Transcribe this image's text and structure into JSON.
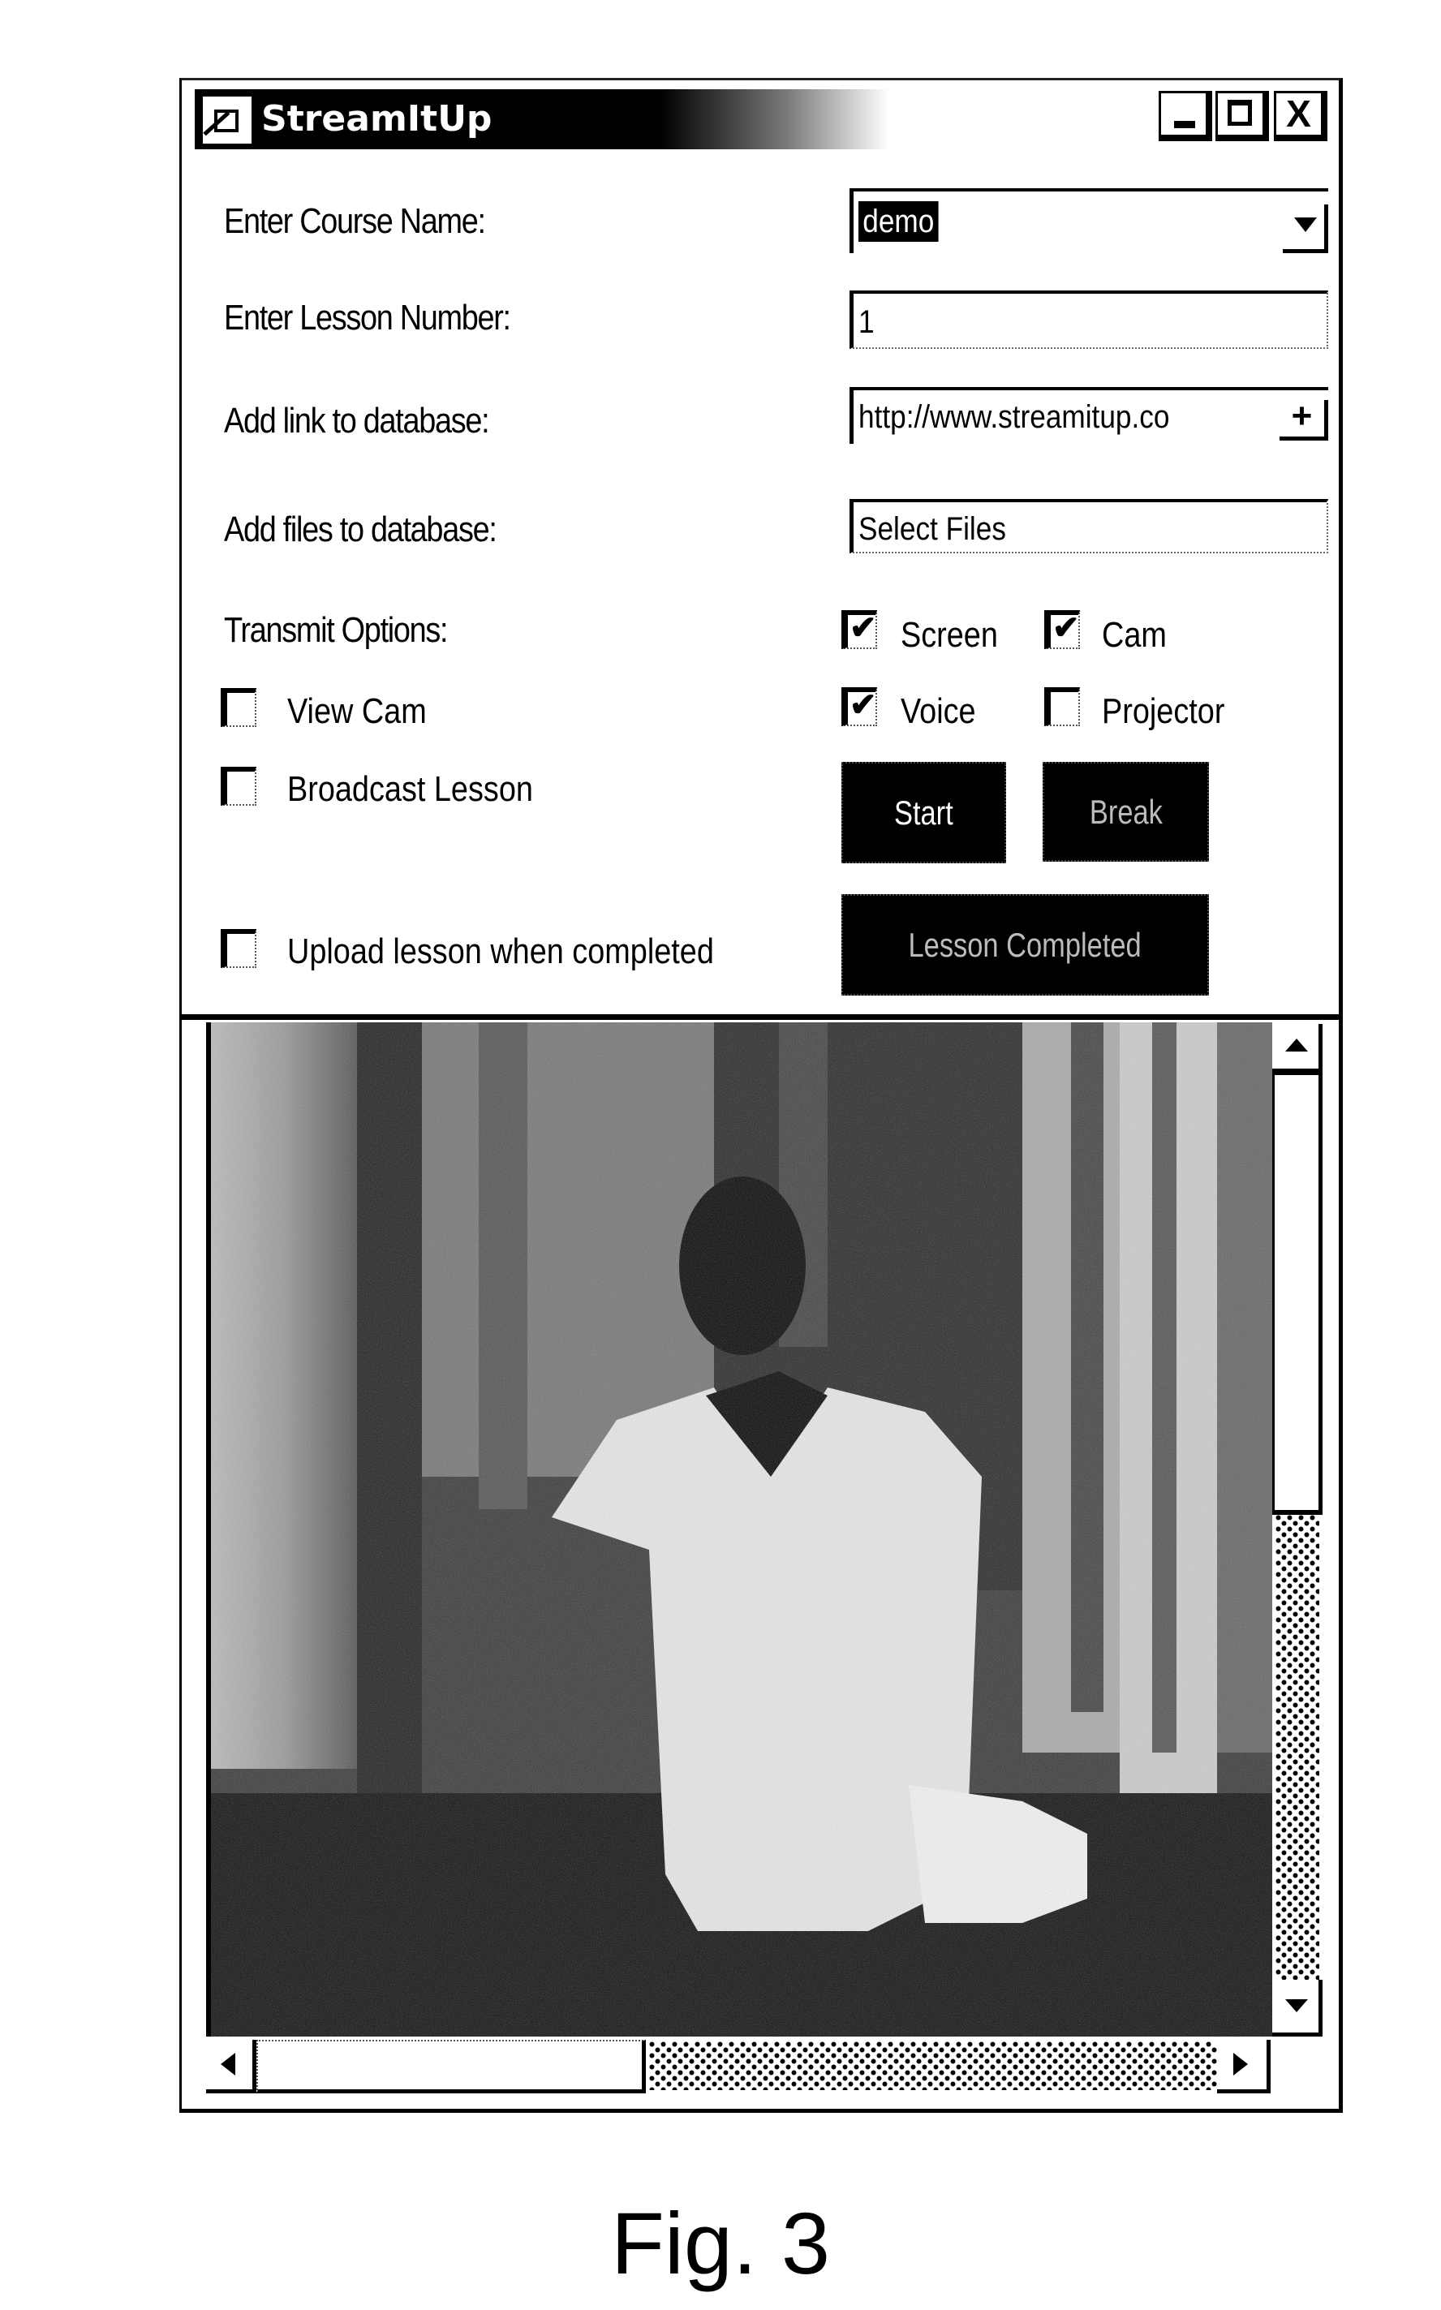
{
  "window": {
    "title": "StreamItUp",
    "controls": {
      "minimize": "minimize",
      "maximize": "maximize",
      "close": "X"
    }
  },
  "form": {
    "course_name_label": "Enter Course Name:",
    "course_name_value": "demo",
    "lesson_number_label": "Enter Lesson Number:",
    "lesson_number_value": "1",
    "link_label": "Add link to database:",
    "link_value": "http://www.streamitup.co",
    "link_add_glyph": "+",
    "files_label": "Add files to database:",
    "files_value": "Select Files",
    "transmit_label": "Transmit Options:"
  },
  "options": {
    "screen": {
      "label": "Screen",
      "checked": true
    },
    "cam": {
      "label": "Cam",
      "checked": true
    },
    "voice": {
      "label": "Voice",
      "checked": true
    },
    "projector": {
      "label": "Projector",
      "checked": false
    },
    "view_cam": {
      "label": "View Cam",
      "checked": false
    },
    "broadcast": {
      "label": "Broadcast Lesson",
      "checked": false
    },
    "upload": {
      "label": "Upload lesson when completed",
      "checked": false
    }
  },
  "buttons": {
    "start": "Start",
    "break": "Break",
    "lesson_completed": "Lesson Completed"
  },
  "check_glyph": "✔",
  "video": {
    "description": "webcam preview of presenter"
  },
  "caption": "Fig. 3"
}
